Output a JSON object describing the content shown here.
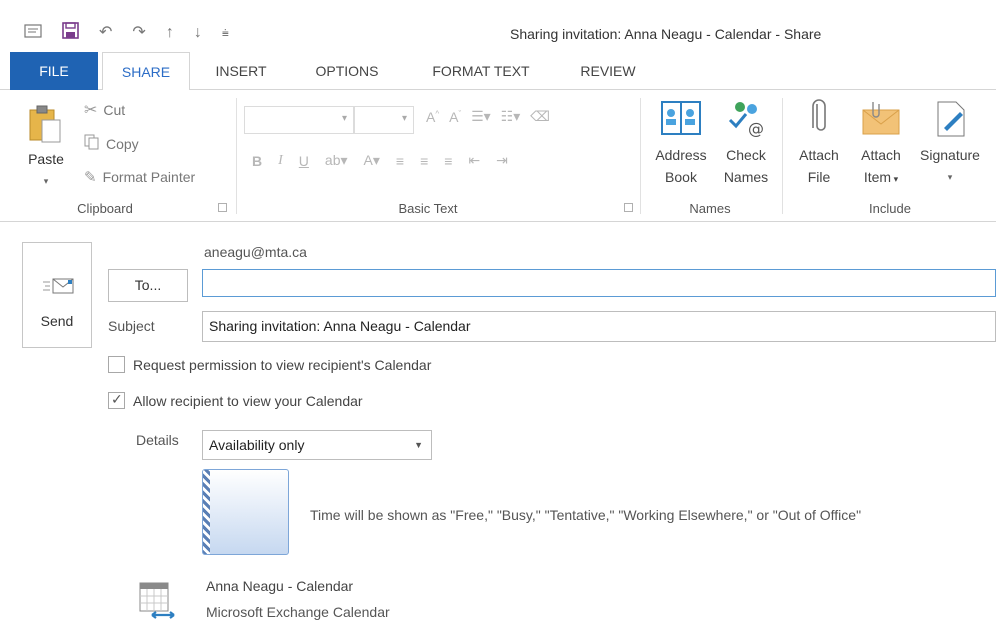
{
  "window": {
    "title": "Sharing invitation: Anna Neagu - Calendar - Share"
  },
  "quick_access": {
    "icons": [
      "message-icon",
      "save-icon",
      "undo-icon",
      "redo-icon",
      "up-arrow-icon",
      "down-arrow-icon",
      "customize-icon"
    ]
  },
  "tabs": [
    {
      "label": "FILE"
    },
    {
      "label": "SHARE"
    },
    {
      "label": "INSERT"
    },
    {
      "label": "OPTIONS"
    },
    {
      "label": "FORMAT TEXT"
    },
    {
      "label": "REVIEW"
    }
  ],
  "ribbon": {
    "clipboard": {
      "paste": "Paste",
      "cut": "Cut",
      "copy": "Copy",
      "format_painter": "Format Painter",
      "group_label": "Clipboard"
    },
    "basic_text": {
      "group_label": "Basic Text",
      "bold": "B",
      "italic": "I",
      "underline": "U"
    },
    "names": {
      "address_book_line1": "Address",
      "address_book_line2": "Book",
      "check_names_line1": "Check",
      "check_names_line2": "Names",
      "group_label": "Names"
    },
    "include": {
      "attach_file_line1": "Attach",
      "attach_file_line2": "File",
      "attach_item_line1": "Attach",
      "attach_item_line2": "Item",
      "signature": "Signature",
      "group_label": "Include"
    }
  },
  "compose": {
    "send_label": "Send",
    "from": "aneagu@mta.ca",
    "to_button": "To...",
    "to_value": "",
    "subject_label": "Subject",
    "subject_value": "Sharing invitation: Anna Neagu - Calendar",
    "request_permission": {
      "label": "Request permission to view recipient's Calendar",
      "checked": false
    },
    "allow_view": {
      "label": "Allow recipient to view your Calendar",
      "checked": true
    },
    "details_label": "Details",
    "details_value": "Availability only",
    "preview_text": "Time will be shown as \"Free,\" \"Busy,\" \"Tentative,\" \"Working Elsewhere,\" or \"Out of Office\"",
    "calendar_name": "Anna Neagu - Calendar",
    "calendar_type": "Microsoft Exchange Calendar"
  },
  "colors": {
    "file_tab": "#1f63b3",
    "active_tab_text": "#2b6cc6",
    "to_field_border": "#5b9bd5"
  }
}
